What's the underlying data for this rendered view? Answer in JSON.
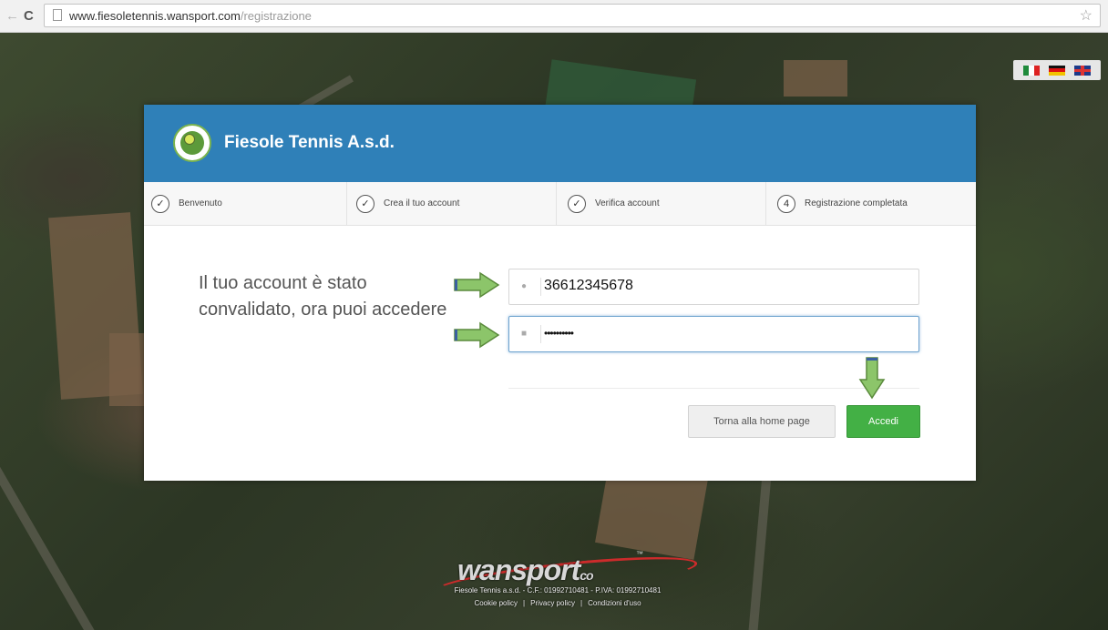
{
  "browser": {
    "url_host": "www.fiesoletennis.wansport.com",
    "url_path": "/registrazione"
  },
  "languages": [
    "it",
    "de",
    "en"
  ],
  "card": {
    "club_name": "Fiesole Tennis A.s.d.",
    "steps": [
      {
        "label": "Benvenuto",
        "state": "done"
      },
      {
        "label": "Crea il tuo account",
        "state": "done"
      },
      {
        "label": "Verifica account",
        "state": "done"
      },
      {
        "label": "Registrazione completata",
        "state": "current",
        "number": "4"
      }
    ],
    "message": "Il tuo account è stato convalidato, ora puoi accedere",
    "username_value": "36612345678",
    "password_value": "••••••••••",
    "home_button": "Torna alla home page",
    "login_button": "Accedi"
  },
  "footer": {
    "brand": "wansport",
    "brand_suffix": "co",
    "legal": "Fiesole Tennis a.s.d. - C.F.: 01992710481 - P.IVA: 01992710481",
    "links": [
      "Cookie policy",
      "Privacy policy",
      "Condizioni d'uso"
    ]
  },
  "colors": {
    "header_blue": "#2f80b8",
    "accent_green": "#43b045",
    "arrow_green": "#8cc56a"
  }
}
